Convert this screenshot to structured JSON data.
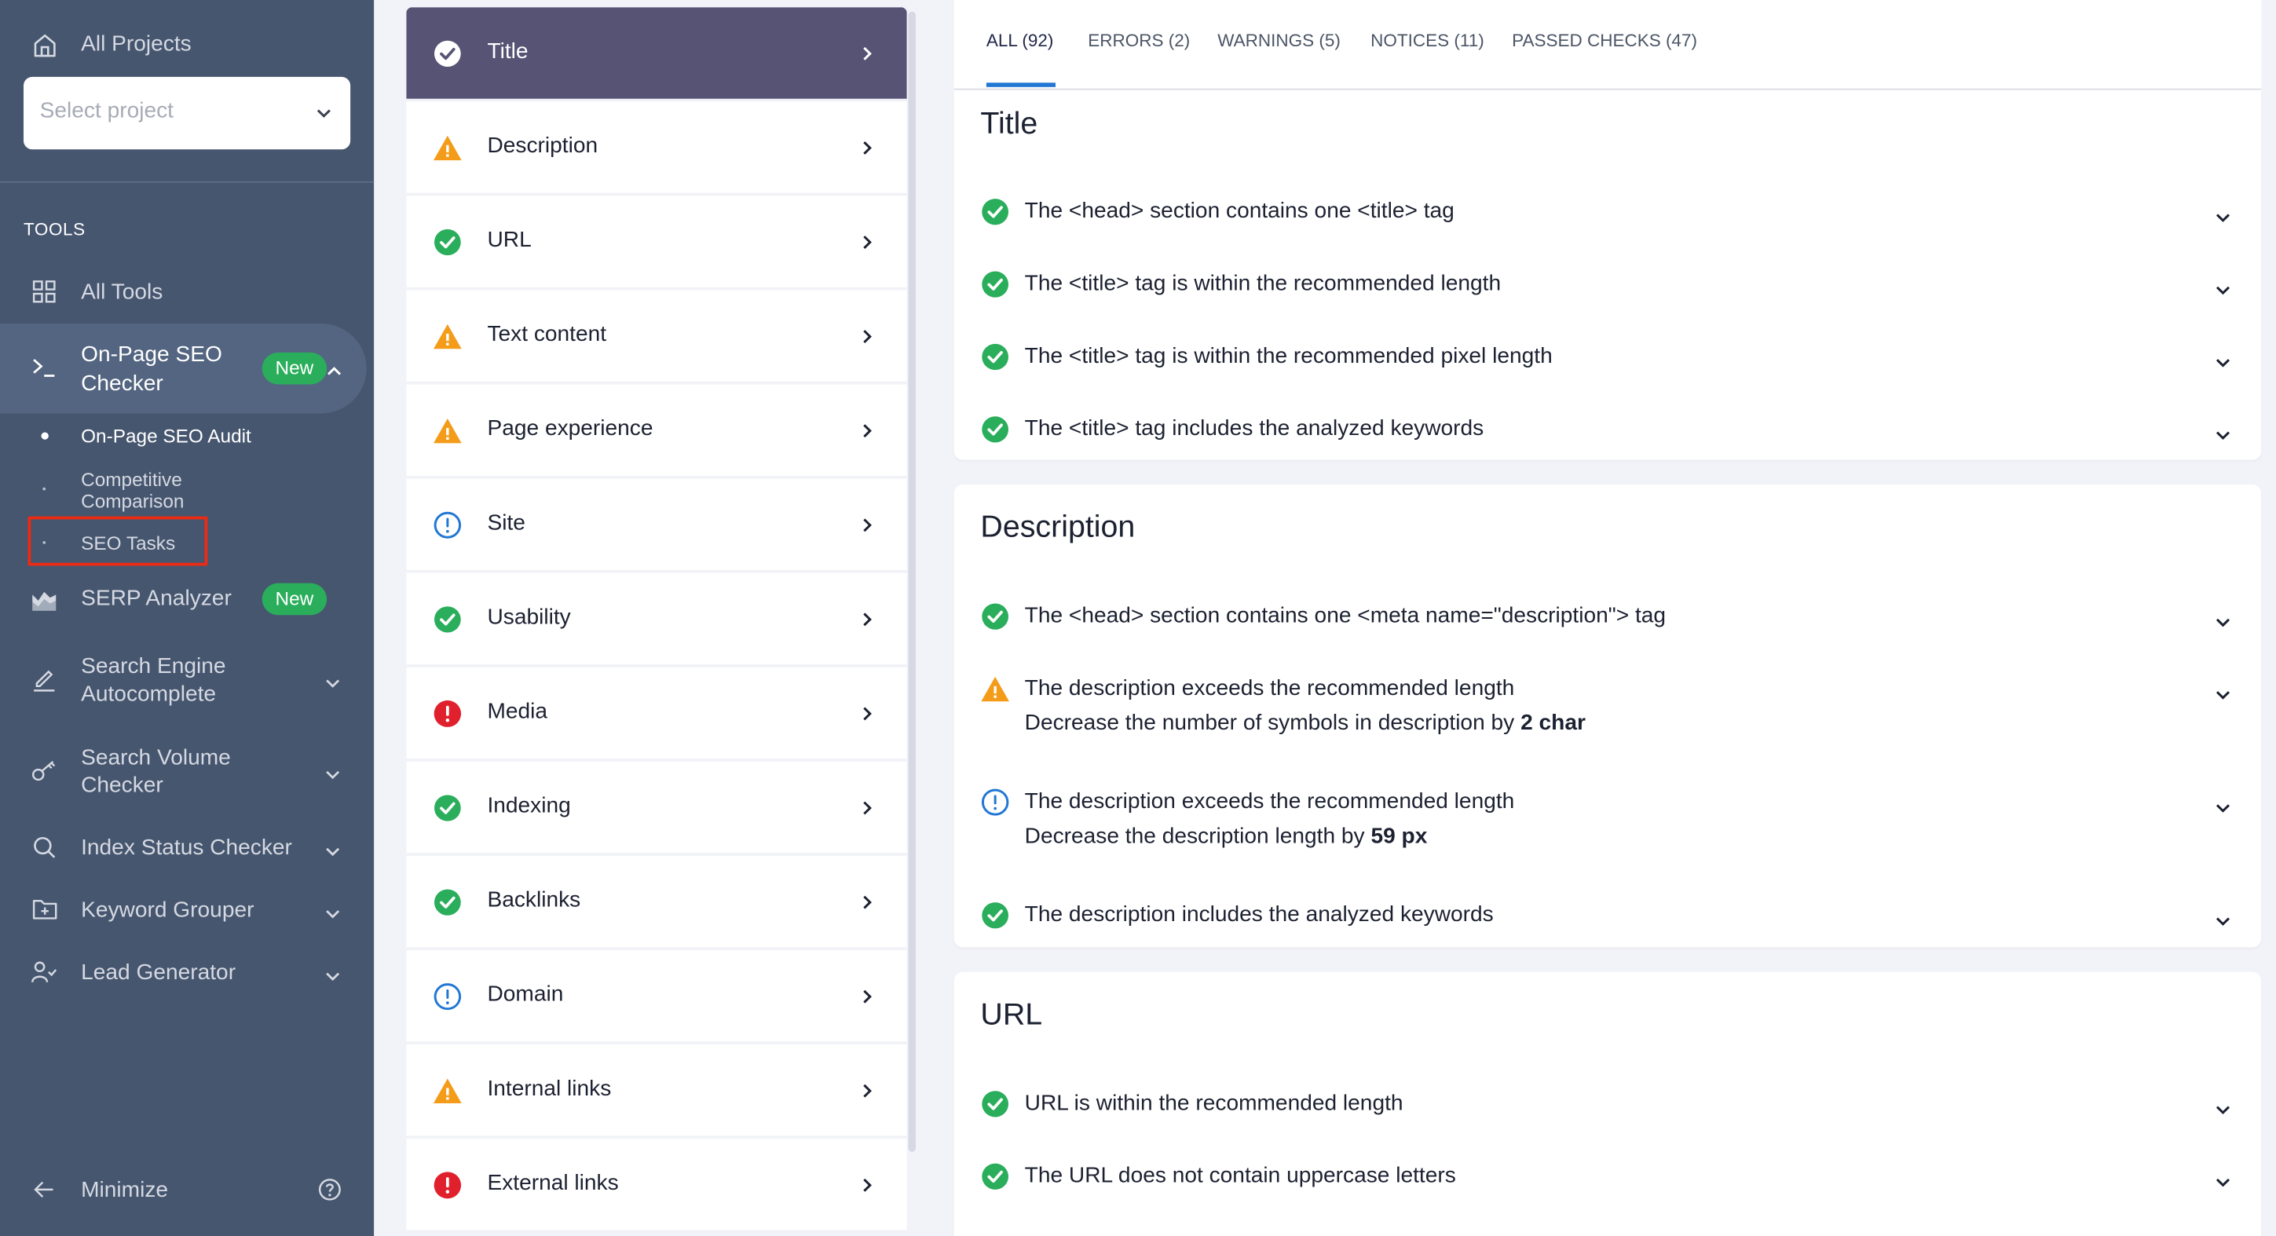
{
  "sidebar": {
    "all_projects": "All Projects",
    "select_placeholder": "Select project",
    "tools_heading": "TOOLS",
    "all_tools": "All Tools",
    "onpage_checker": {
      "line1": "On-Page SEO",
      "line2": "Checker",
      "badge": "New"
    },
    "sub_items": [
      {
        "label": "On-Page SEO Audit",
        "active": true
      },
      {
        "label_line1": "Competitive",
        "label_line2": "Comparison",
        "active": false
      },
      {
        "label": "SEO Tasks",
        "active": false,
        "highlighted": true
      }
    ],
    "serp_analyzer": {
      "label": "SERP Analyzer",
      "badge": "New"
    },
    "search_engine_autocomplete": {
      "line1": "Search Engine",
      "line2": "Autocomplete"
    },
    "search_volume_checker": {
      "line1": "Search Volume",
      "line2": "Checker"
    },
    "index_status_checker": "Index Status Checker",
    "keyword_grouper": "Keyword Grouper",
    "lead_generator": "Lead Generator",
    "minimize": "Minimize"
  },
  "categories": [
    {
      "label": "Title",
      "status": "passed",
      "active": true
    },
    {
      "label": "Description",
      "status": "warning"
    },
    {
      "label": "URL",
      "status": "passed"
    },
    {
      "label": "Text content",
      "status": "warning"
    },
    {
      "label": "Page experience",
      "status": "warning"
    },
    {
      "label": "Site",
      "status": "notice"
    },
    {
      "label": "Usability",
      "status": "passed"
    },
    {
      "label": "Media",
      "status": "error"
    },
    {
      "label": "Indexing",
      "status": "passed"
    },
    {
      "label": "Backlinks",
      "status": "passed"
    },
    {
      "label": "Domain",
      "status": "notice"
    },
    {
      "label": "Internal links",
      "status": "warning"
    },
    {
      "label": "External links",
      "status": "error"
    }
  ],
  "tabs": [
    {
      "label": "ALL (92)",
      "active": true
    },
    {
      "label": "ERRORS (2)"
    },
    {
      "label": "WARNINGS (5)"
    },
    {
      "label": "NOTICES (11)"
    },
    {
      "label": "PASSED CHECKS (47)"
    }
  ],
  "sections": {
    "title": {
      "heading": "Title",
      "checks": [
        {
          "status": "passed",
          "text": "The <head> section contains one <title> tag"
        },
        {
          "status": "passed",
          "text": "The <title> tag is within the recommended length"
        },
        {
          "status": "passed",
          "text": "The <title> tag is within the recommended pixel length"
        },
        {
          "status": "passed",
          "text": "The <title> tag includes the analyzed keywords"
        }
      ]
    },
    "description": {
      "heading": "Description",
      "checks": [
        {
          "status": "passed",
          "text": "The <head> section contains one <meta name=\"description\"> tag"
        },
        {
          "status": "warning",
          "text": "The description exceeds the recommended length",
          "detail": "Decrease the number of symbols in description by",
          "detail_value": "2 char"
        },
        {
          "status": "notice",
          "text": "The description exceeds the recommended length",
          "detail": "Decrease the description length by",
          "detail_value": "59 px"
        },
        {
          "status": "passed",
          "text": "The description includes the analyzed keywords"
        }
      ]
    },
    "url": {
      "heading": "URL",
      "checks": [
        {
          "status": "passed",
          "text": "URL is within the recommended length"
        },
        {
          "status": "passed",
          "text": "The URL does not contain uppercase letters"
        }
      ]
    }
  },
  "colors": {
    "sidebar_bg": "#46566f",
    "active_category": "#575375",
    "passed": "#2aae5b",
    "warning": "#f49c1a",
    "notice": "#2277d4",
    "error": "#e0212d",
    "new_badge": "#2aae5b",
    "tab_underline": "#2277d4"
  }
}
